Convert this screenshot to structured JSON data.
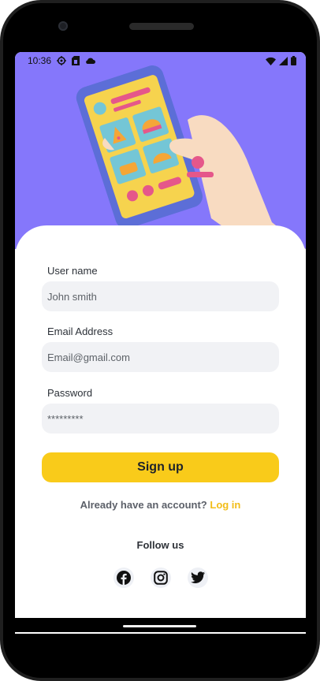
{
  "status_bar": {
    "time": "10:36",
    "left_icons": [
      "sync-icon",
      "sim-card-icon",
      "cloud-icon"
    ],
    "right_icons": [
      "wifi-icon",
      "signal-icon",
      "battery-icon"
    ]
  },
  "form": {
    "username": {
      "label": "User name",
      "placeholder": "John smith"
    },
    "email": {
      "label": "Email Address",
      "placeholder": "Email@gmail.com"
    },
    "password": {
      "label": "Password",
      "value": "*********"
    }
  },
  "signup_button": "Sign up",
  "account_prompt": "Already have an account?",
  "login_link": "Log in",
  "follow_label": "Follow us",
  "social": [
    "facebook-icon",
    "instagram-icon",
    "twitter-icon"
  ],
  "colors": {
    "hero": "#8577fb",
    "accent": "#f9cb1a",
    "link": "#f2bd18",
    "input_bg": "#f1f2f5"
  }
}
